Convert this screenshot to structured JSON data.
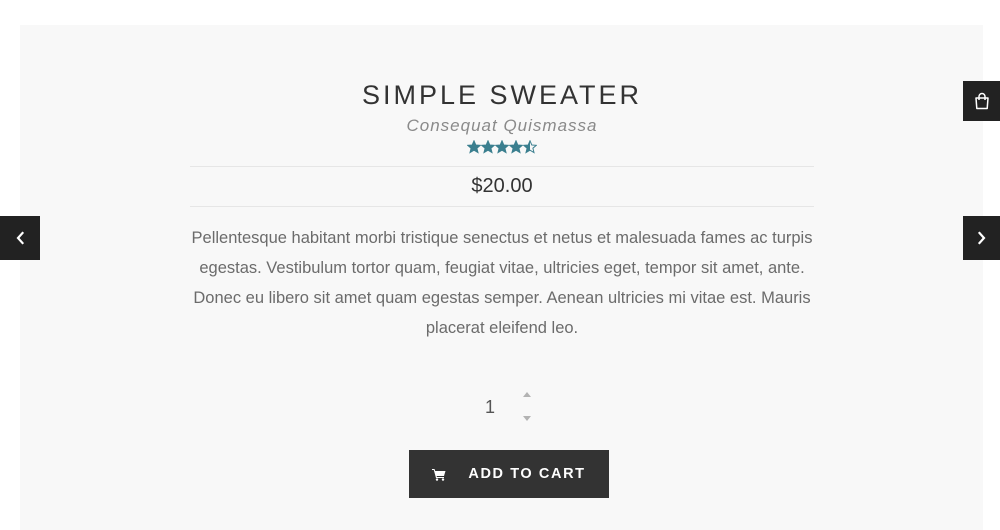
{
  "product": {
    "title": "SIMPLE SWEATER",
    "subtitle": "Consequat Quismassa",
    "rating": 4.5,
    "rating_max": 5,
    "price": "$20.00",
    "description": "Pellentesque habitant morbi tristique senectus et netus et malesuada fames ac turpis egestas. Vestibulum tortor quam, feugiat vitae, ultricies eget, tempor sit amet, ante. Donec eu libero sit amet quam egestas semper. Aenean ultricies mi vitae est. Mauris placerat eleifend leo."
  },
  "cart": {
    "quantity": "1",
    "add_label": "ADD TO CART"
  },
  "icons": {
    "prev": "chevron-left-icon",
    "next": "chevron-right-icon",
    "bag": "shopping-bag-icon",
    "cart": "cart-icon",
    "star": "star-icon"
  },
  "colors": {
    "star_fill": "#3b7f8f",
    "star_empty": "#c8c8c8",
    "button_bg": "#333333",
    "nav_bg": "#222222",
    "panel_bg": "#f8f8f8"
  }
}
